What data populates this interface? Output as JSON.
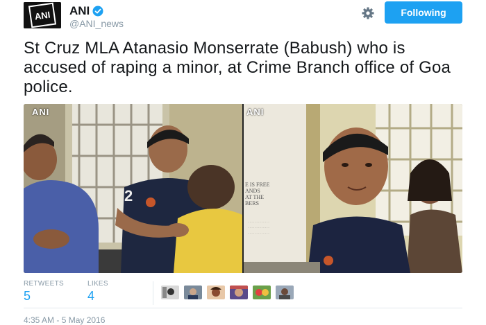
{
  "account": {
    "name": "ANI",
    "handle": "@ANI_news",
    "verified": true,
    "avatar_text": "ANI"
  },
  "actions": {
    "follow_label": "Following",
    "settings_icon": "gear-icon"
  },
  "tweet": {
    "text": "St Cruz MLA Atanasio Monserrate (Babush) who is accused of raping a minor, at Crime Branch office of Goa police.",
    "timestamp": "4:35 AM - 5 May 2016"
  },
  "media": {
    "left_watermark": "ANI",
    "right_watermark": "ANI",
    "sign_lines": [
      "E IS FREE",
      "ANDS",
      "AT THE",
      "BERS"
    ]
  },
  "stats": {
    "retweets_label": "RETWEETS",
    "retweets_value": "5",
    "likes_label": "LIKES",
    "likes_value": "4"
  },
  "colors": {
    "accent": "#1da1f2",
    "muted": "#8899a6",
    "text": "#14171a"
  }
}
